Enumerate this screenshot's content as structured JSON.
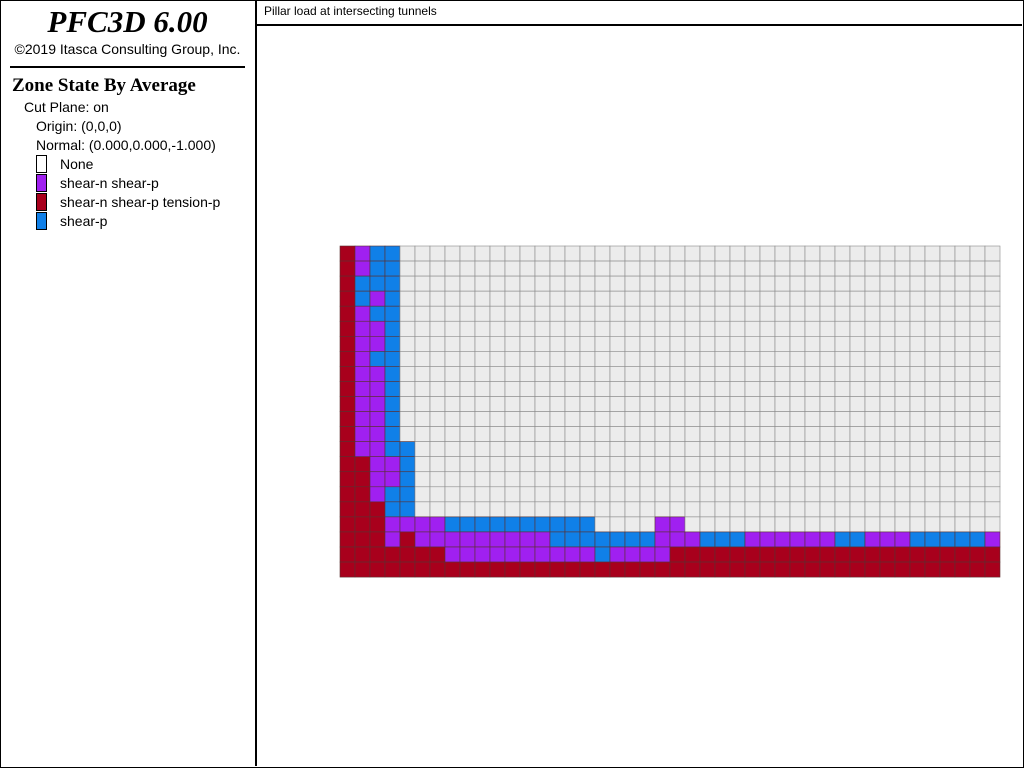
{
  "app": {
    "title": "PFC3D 6.00",
    "copyright": "©2019 Itasca Consulting Group, Inc."
  },
  "legend": {
    "title": "Zone State By Average",
    "cut_plane": "Cut Plane: on",
    "origin": "Origin: (0,0,0)",
    "normal": "Normal: (0.000,0.000,-1.000)",
    "items": [
      {
        "label": "None",
        "color": "#ffffff"
      },
      {
        "label": "shear-n shear-p",
        "color": "#a020f0"
      },
      {
        "label": "shear-n shear-p tension-p",
        "color": "#a8001c"
      },
      {
        "label": "shear-p",
        "color": "#1080e8"
      }
    ]
  },
  "viewport": {
    "title": "Pillar load at intersecting tunnels"
  },
  "zone_colors": {
    "R": "#a8001c",
    "P": "#a020f0",
    "B": "#1080e8",
    "W": "#ececec"
  },
  "zone_map": [
    "RPBB.........................................",
    "RPBB.........................................",
    "RBBB.........................................",
    "RBPB.........................................",
    "RPBB.........................................",
    "RPPB.........................................",
    "RPPB.........................................",
    "RPBB.........................................",
    "RPPB.........................................",
    "RPPB.........................................",
    "RPPB.........................................",
    "RPPB.........................................",
    "RPPB.........................................",
    "RPPBB........................................",
    "RRPPB........................................",
    "RRPPB........................................",
    "RRPBB........................................",
    "RRRBB........................................",
    "RRRPPPPBBBBBBBBBBW...PP......................",
    "RRRPRPPPPPPPPPBBBBBBBPPPBBBPPPPPPBBPPPBBBBBP",
    "RRRRRRRPPPPPPPPPPBPPPPRRRRRRRRRRRRRRRRRRRRRRR",
    "RRRRRRRRRRRRRRRRRRRRRRRRRRRRRRRRRRRRRRRRRRRRR"
  ]
}
